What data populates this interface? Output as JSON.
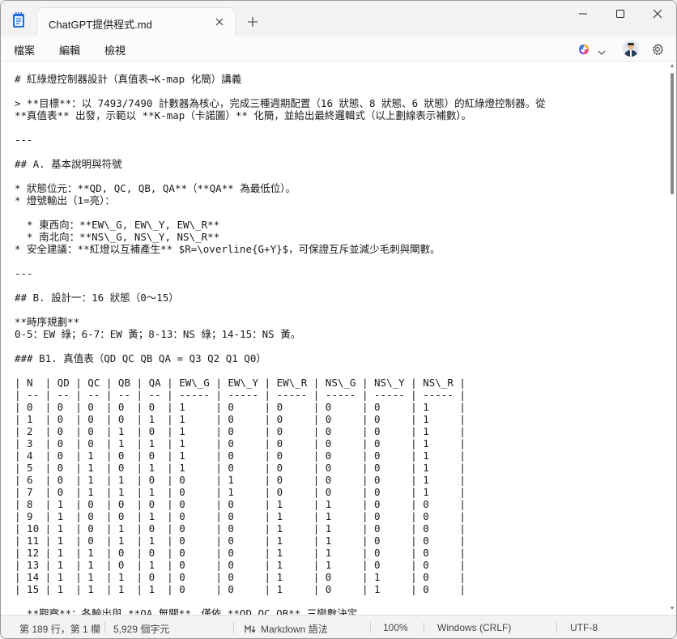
{
  "tab": {
    "title": "ChatGPT提供程式.md"
  },
  "menu": {
    "file": "檔案",
    "edit": "編輯",
    "view": "檢視"
  },
  "editor": {
    "lines": [
      "# 紅綠燈控制器設計（真值表→K-map 化簡）講義",
      "",
      "> **目標**：以 7493/7490 計數器為核心，完成三種週期配置（16 狀態、8 狀態、6 狀態）的紅綠燈控制器。從",
      "**真值表** 出發，示範以 **K-map（卡諾圖）** 化簡，並給出最終邏輯式（以上劃線表示補數）。",
      "",
      "---",
      "",
      "## A. 基本說明與符號",
      "",
      "* 狀態位元：**QD, QC, QB, QA**（**QA** 為最低位）。",
      "* 燈號輸出（1=亮）：",
      "",
      "  * 東西向：**EW\\_G, EW\\_Y, EW\\_R**",
      "  * 南北向：**NS\\_G, NS\\_Y, NS\\_R**",
      "* 安全建議：**紅燈以互補產生** $R=\\overline{G+Y}$，可保證互斥並減少毛刺與閘數。",
      "",
      "---",
      "",
      "## B. 設計一：16 狀態（0～15）",
      "",
      "**時序規劃**",
      "0-5：EW 綠；6-7：EW 黃；8-13：NS 綠；14-15：NS 黃。",
      "",
      "### B1. 真值表（QD QC QB QA = Q3 Q2 Q1 Q0）",
      "",
      "| N  | QD | QC | QB | QA | EW\\_G | EW\\_Y | EW\\_R | NS\\_G | NS\\_Y | NS\\_R |",
      "| -- | -- | -- | -- | -- | ----- | ----- | ----- | ----- | ----- | ----- |",
      "| 0  | 0  | 0  | 0  | 0  | 1     | 0     | 0     | 0     | 0     | 1     |",
      "| 1  | 0  | 0  | 0  | 1  | 1     | 0     | 0     | 0     | 0     | 1     |",
      "| 2  | 0  | 0  | 1  | 0  | 1     | 0     | 0     | 0     | 0     | 1     |",
      "| 3  | 0  | 0  | 1  | 1  | 1     | 0     | 0     | 0     | 0     | 1     |",
      "| 4  | 0  | 1  | 0  | 0  | 1     | 0     | 0     | 0     | 0     | 1     |",
      "| 5  | 0  | 1  | 0  | 1  | 1     | 0     | 0     | 0     | 0     | 1     |",
      "| 6  | 0  | 1  | 1  | 0  | 0     | 1     | 0     | 0     | 0     | 1     |",
      "| 7  | 0  | 1  | 1  | 1  | 0     | 1     | 0     | 0     | 0     | 1     |",
      "| 8  | 1  | 0  | 0  | 0  | 0     | 0     | 1     | 1     | 0     | 0     |",
      "| 9  | 1  | 0  | 0  | 1  | 0     | 0     | 1     | 1     | 0     | 0     |",
      "| 10 | 1  | 0  | 1  | 0  | 0     | 0     | 1     | 1     | 0     | 0     |",
      "| 11 | 1  | 0  | 1  | 1  | 0     | 0     | 1     | 1     | 0     | 0     |",
      "| 12 | 1  | 1  | 0  | 0  | 0     | 0     | 1     | 1     | 0     | 0     |",
      "| 13 | 1  | 1  | 0  | 1  | 0     | 0     | 1     | 1     | 0     | 0     |",
      "| 14 | 1  | 1  | 1  | 0  | 0     | 0     | 1     | 0     | 1     | 0     |",
      "| 15 | 1  | 1  | 1  | 1  | 0     | 0     | 1     | 0     | 1     | 0     |",
      "",
      "  **觀察**：各輸出與 **QA 無關**，僅依 **QD QC QB** 三變數決定。"
    ]
  },
  "status": {
    "position": "第 189 行，第 1 欄",
    "chars": "5,929 個字元",
    "syntax": "Markdown 語法",
    "zoom": "100%",
    "line_ending": "Windows (CRLF)",
    "encoding": "UTF-8"
  },
  "colors": {
    "accent_icon": "#1e6fd9",
    "titlebar_bg": "#f3f3f3",
    "editor_bg": "#ffffff"
  }
}
